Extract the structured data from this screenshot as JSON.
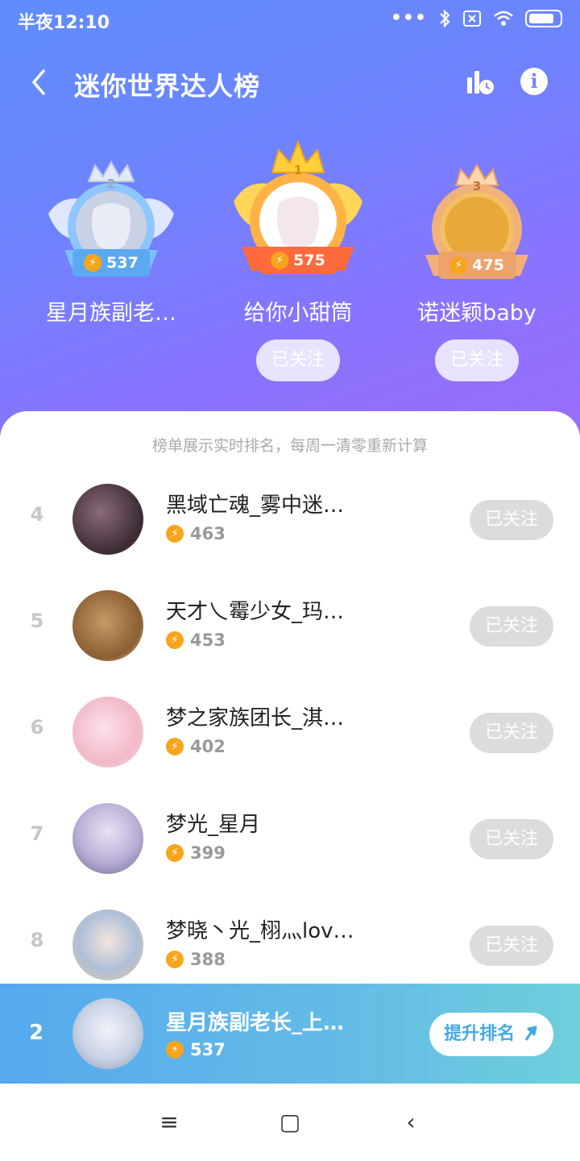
{
  "status_bar": {
    "time": "半夜12:10",
    "dots": "•••"
  },
  "header": {
    "title": "迷你世界达人榜"
  },
  "icons": {
    "back": "chevron-left-icon",
    "stats": "bar-chart-clock-icon",
    "info": "info-icon",
    "bolt": "lightning-icon"
  },
  "colors": {
    "hero_start": "#5f8dff",
    "hero_end": "#9b6dfa",
    "gold": "#f7a51c",
    "followed": "#dcdcdc",
    "my_bar_start": "#55a9ee",
    "my_bar_end": "#6fcfdb"
  },
  "podium": [
    {
      "rank": "2",
      "name": "星月族副老…",
      "score": "537",
      "follow_label": ""
    },
    {
      "rank": "1",
      "name": "给你小甜筒",
      "score": "575",
      "follow_label": "已关注"
    },
    {
      "rank": "3",
      "name": "诺迷颖baby",
      "score": "475",
      "follow_label": "已关注"
    }
  ],
  "list": {
    "note": "榜单展示实时排名，每周一清零重新计算",
    "rows": [
      {
        "rank": "4",
        "name": "黑域亡魂_雾中迷…",
        "score": "463",
        "follow_label": "已关注"
      },
      {
        "rank": "5",
        "name": "天才乀霉少女_玛…",
        "score": "453",
        "follow_label": "已关注"
      },
      {
        "rank": "6",
        "name": "梦之家族团长_淇…",
        "score": "402",
        "follow_label": "已关注"
      },
      {
        "rank": "7",
        "name": "梦光_星月",
        "score": "399",
        "follow_label": "已关注"
      },
      {
        "rank": "8",
        "name": "梦晓丶光_栩灬lov…",
        "score": "388",
        "follow_label": "已关注"
      }
    ]
  },
  "my_rank": {
    "rank": "2",
    "name": "星月族副老长_上…",
    "score": "537",
    "boost_label": "提升排名"
  },
  "system_nav": {
    "menu": "≡",
    "home": "▢",
    "back": "‹"
  }
}
